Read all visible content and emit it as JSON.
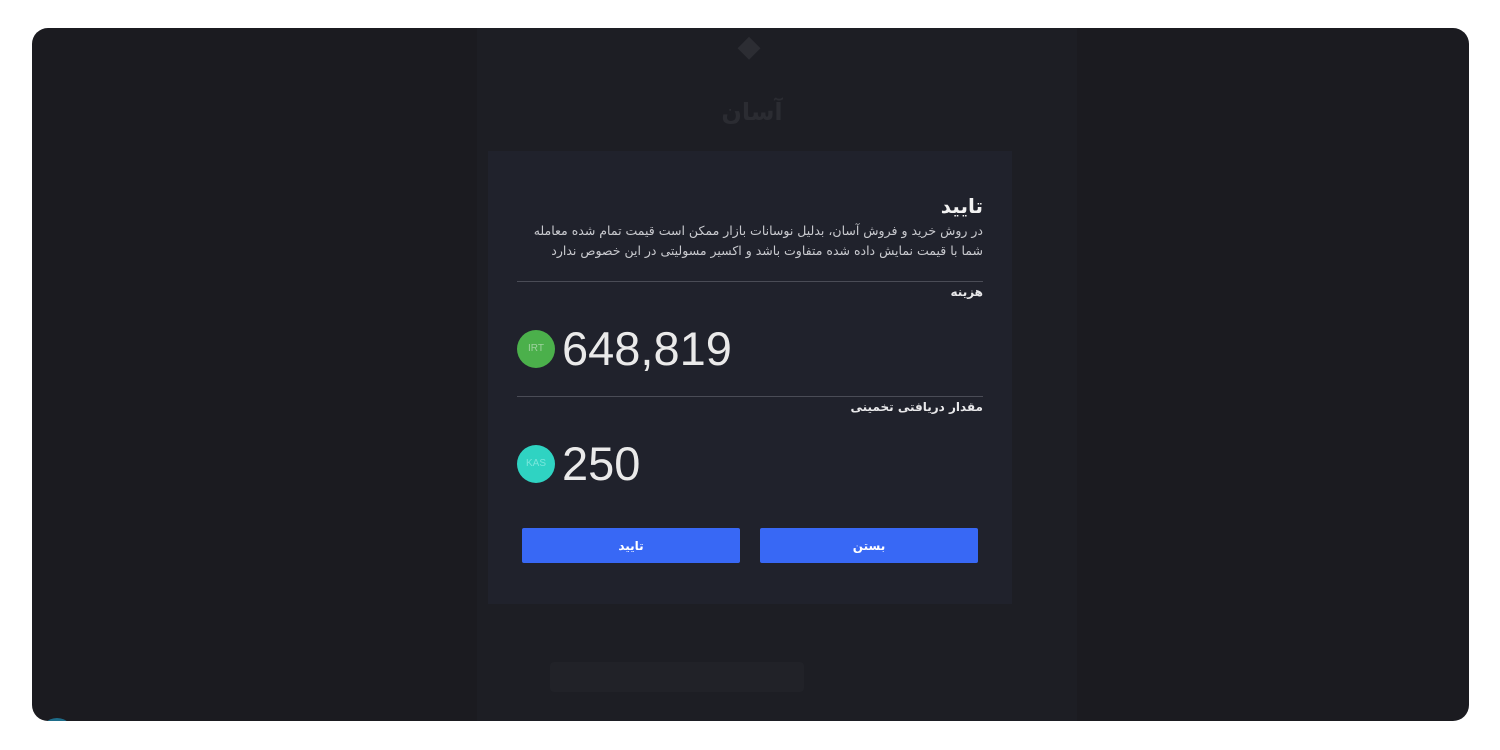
{
  "background": {
    "logo_icon": "brand-logo-icon",
    "title": "آسان"
  },
  "modal": {
    "title": "تایید",
    "description": "در روش خرید و فروش آسان، بدلیل نوسانات بازار ممکن است قیمت تمام شده معامله شما با قیمت نمایش داده شده متفاوت باشد و اکسیر مسولیتی در این خصوص ندارد",
    "cost": {
      "label": "هزینه",
      "currency": "IRT",
      "value": "648,819",
      "badge_color": "#4bb04b"
    },
    "estimated": {
      "label": "مقدار دریافتی تخمینی",
      "currency": "KAS",
      "value": "250",
      "badge_color": "#2fd3c2"
    },
    "buttons": {
      "confirm_label": "تایید",
      "close_label": "بستن",
      "color": "#3868f5"
    }
  }
}
